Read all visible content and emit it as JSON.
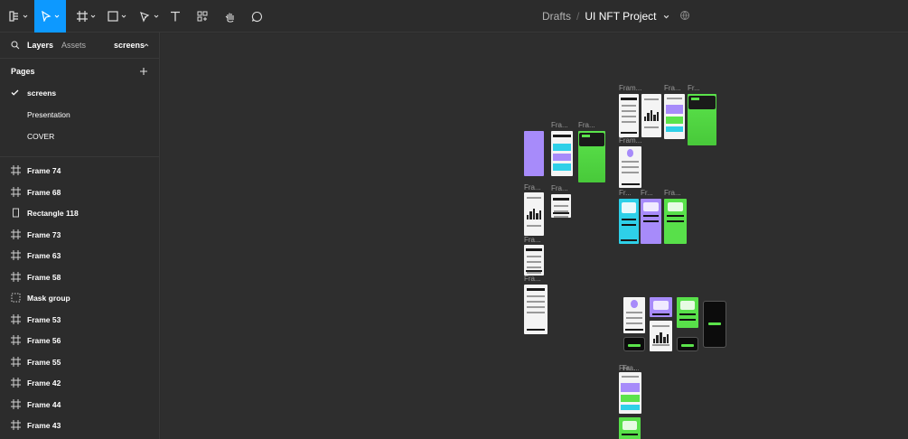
{
  "toolbar": {
    "tools": [
      {
        "name": "main-menu-tool",
        "icon": "menu-icon"
      },
      {
        "name": "move-tool",
        "icon": "cursor-icon",
        "active": true
      },
      {
        "name": "frame-tool",
        "icon": "frame-icon"
      },
      {
        "name": "shape-tool",
        "icon": "rectangle-icon"
      },
      {
        "name": "pen-tool",
        "icon": "pen-icon"
      },
      {
        "name": "text-tool",
        "icon": "text-icon"
      },
      {
        "name": "resources-tool",
        "icon": "components-icon"
      },
      {
        "name": "hand-tool",
        "icon": "hand-icon"
      },
      {
        "name": "comment-tool",
        "icon": "comment-icon"
      }
    ],
    "breadcrumb": {
      "folder": "Drafts",
      "separator": "/",
      "project": "UI NFT Project"
    },
    "accent": "#0d99ff"
  },
  "sidebar": {
    "tabs": {
      "layers": "Layers",
      "assets": "Assets",
      "current_page": "screens"
    },
    "pages_heading": "Pages",
    "pages": [
      {
        "label": "screens",
        "current": true
      },
      {
        "label": "Presentation",
        "current": false
      },
      {
        "label": "COVER",
        "current": false
      }
    ],
    "layers": [
      {
        "label": "Frame 74",
        "icon": "frame-icon"
      },
      {
        "label": "Frame 68",
        "icon": "frame-icon"
      },
      {
        "label": "Rectangle 118",
        "icon": "rectangle-icon"
      },
      {
        "label": "Frame 73",
        "icon": "frame-icon"
      },
      {
        "label": "Frame 63",
        "icon": "frame-icon"
      },
      {
        "label": "Frame 58",
        "icon": "frame-icon"
      },
      {
        "label": "Mask group",
        "icon": "mask-group-icon"
      },
      {
        "label": "Frame 53",
        "icon": "frame-icon"
      },
      {
        "label": "Frame 56",
        "icon": "frame-icon"
      },
      {
        "label": "Frame 55",
        "icon": "frame-icon"
      },
      {
        "label": "Frame 42",
        "icon": "frame-icon"
      },
      {
        "label": "Frame 44",
        "icon": "frame-icon"
      },
      {
        "label": "Frame 43",
        "icon": "frame-icon"
      }
    ]
  },
  "canvas": {
    "frame_labels": [
      "Fra...",
      "Fra...",
      "Fram...",
      "Fra...",
      "Fr...",
      "Fram...",
      "Fra...",
      "Fra...",
      "Fra...",
      "Fra...",
      "Fr...",
      "Fr...",
      "Fra...",
      "Fra...",
      "Fra..."
    ]
  }
}
